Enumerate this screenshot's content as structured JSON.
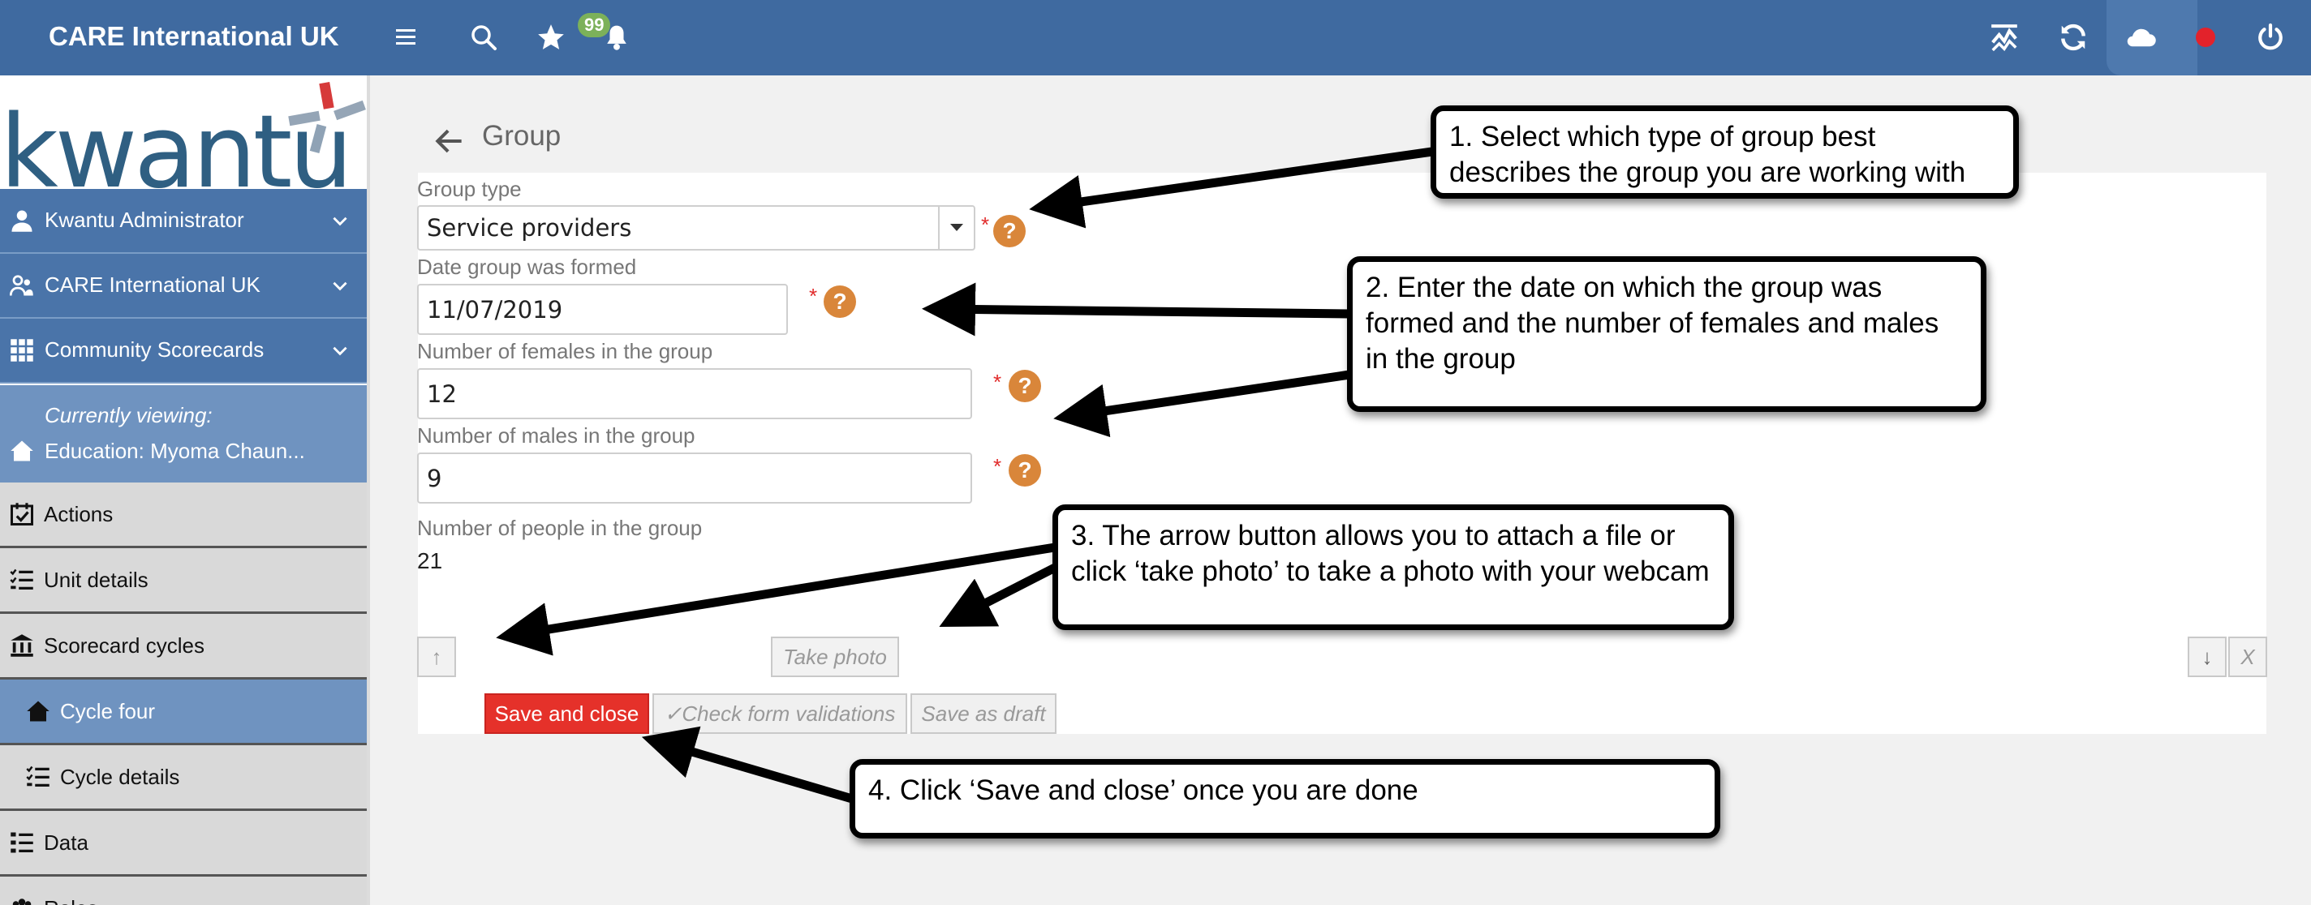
{
  "topbar": {
    "brand": "CARE International UK",
    "notification_count": "99",
    "icons": [
      "menu-icon",
      "search-icon",
      "star-icon",
      "bell-icon",
      "chart-icon",
      "sync-icon",
      "cloud-icon",
      "status-dot-icon",
      "power-icon"
    ],
    "accent_color": "#3f6aa0"
  },
  "sidebar": {
    "logo_text": "kwantu",
    "items_top": [
      {
        "label": "Kwantu Administrator",
        "icon": "user-icon"
      },
      {
        "label": "CARE International UK",
        "icon": "users-icon"
      },
      {
        "label": "Community Scorecards",
        "icon": "grid-icon"
      }
    ],
    "viewing_label": "Currently viewing:",
    "viewing_value": "Education: Myoma Chaun...",
    "items": [
      {
        "label": "Actions",
        "icon": "calendar-check-icon"
      },
      {
        "label": "Unit details",
        "icon": "list-icon"
      },
      {
        "label": "Scorecard cycles",
        "icon": "building-icon"
      },
      {
        "label": "Cycle four",
        "icon": "home-icon"
      },
      {
        "label": "Cycle details",
        "icon": "list-icon"
      },
      {
        "label": "Data",
        "icon": "list-icon"
      },
      {
        "label": "Roles",
        "icon": "roles-icon"
      }
    ]
  },
  "page": {
    "title": "Group"
  },
  "form": {
    "group_type_label": "Group type",
    "group_type_value": "Service providers",
    "date_label": "Date group was formed",
    "date_value": "11/07/2019",
    "females_label": "Number of females in the group",
    "females_value": "12",
    "males_label": "Number of males in the group",
    "males_value": "9",
    "people_label": "Number of people in the group",
    "people_value": "21",
    "required_mark": "*",
    "help_mark": "?",
    "upload_label": "↑",
    "take_photo_label": "Take photo",
    "download_label": "↓",
    "remove_label": "X"
  },
  "buttons": {
    "save_close": "Save and close",
    "check_validations": "✓Check form validations",
    "save_draft": "Save as draft"
  },
  "callouts": {
    "c1": "1. Select which type of group best describes the group you are working with",
    "c2": "2. Enter the date on which the group was formed and the number of females and males in the group",
    "c3": "3. The arrow button allows you to attach a file or click ‘take photo’ to take a photo with your webcam",
    "c4": "4. Click ‘Save and close’ once you are done"
  }
}
